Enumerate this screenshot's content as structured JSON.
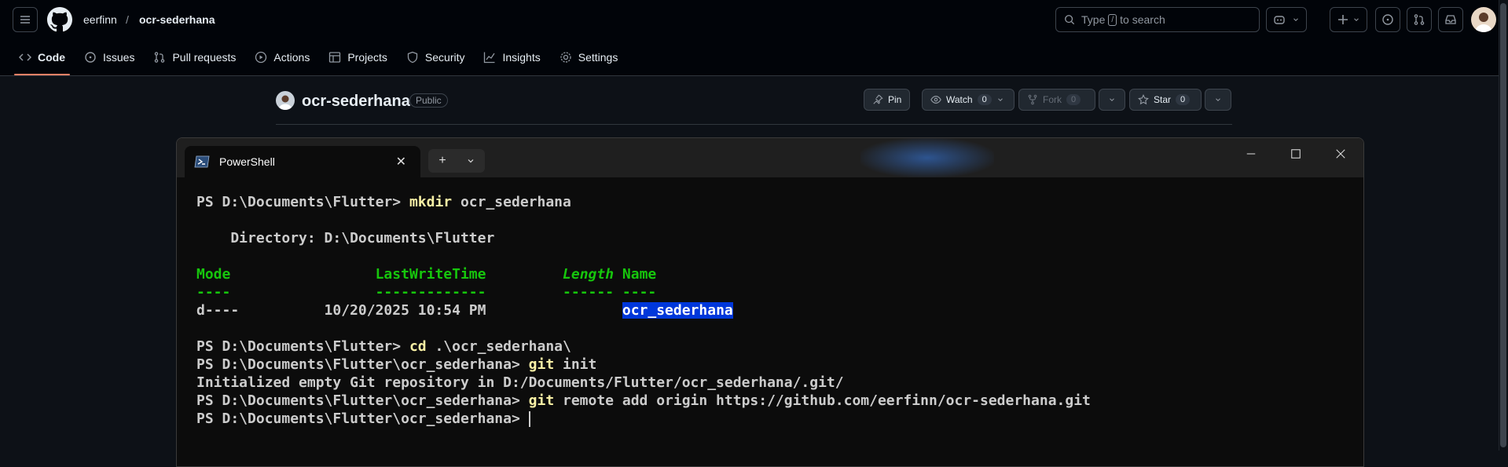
{
  "github": {
    "owner": "eerfinn",
    "separator": "/",
    "repo": "ocr-sederhana",
    "search_placeholder_prefix": "Type",
    "search_key": "/",
    "search_placeholder_suffix": "to search",
    "nav": [
      {
        "label": "Code",
        "icon": "code-icon",
        "active": true
      },
      {
        "label": "Issues",
        "icon": "issue-icon"
      },
      {
        "label": "Pull requests",
        "icon": "pull-request-icon"
      },
      {
        "label": "Actions",
        "icon": "play-icon"
      },
      {
        "label": "Projects",
        "icon": "table-icon"
      },
      {
        "label": "Security",
        "icon": "shield-icon"
      },
      {
        "label": "Insights",
        "icon": "graph-icon"
      },
      {
        "label": "Settings",
        "icon": "gear-icon"
      }
    ],
    "repo_title": "ocr-sederhana",
    "visibility": "Public",
    "pin_label": "Pin",
    "watch_label": "Watch",
    "watch_count": "0",
    "fork_label": "Fork",
    "fork_count": "0",
    "star_label": "Star",
    "star_count": "0",
    "accent": "#f78166"
  },
  "terminal": {
    "tab_title": "PowerShell",
    "lines": [
      {
        "parts": [
          {
            "t": "PS D:\\Documents\\Flutter> "
          },
          {
            "t": "mkdir",
            "c": "cmd"
          },
          {
            "t": " ocr_sederhana"
          }
        ]
      },
      {
        "parts": [
          {
            "t": ""
          }
        ]
      },
      {
        "parts": [
          {
            "t": "    Directory: D:\\Documents\\Flutter"
          }
        ]
      },
      {
        "parts": [
          {
            "t": ""
          }
        ]
      },
      {
        "parts": [
          {
            "t": "Mode",
            "c": "hdr"
          },
          {
            "t": "                 "
          },
          {
            "t": "LastWriteTime",
            "c": "hdr"
          },
          {
            "t": "         "
          },
          {
            "t": "Length",
            "c": "hdr-it"
          },
          {
            "t": " "
          },
          {
            "t": "Name",
            "c": "hdr"
          }
        ]
      },
      {
        "parts": [
          {
            "t": "----",
            "c": "hdr"
          },
          {
            "t": "                 "
          },
          {
            "t": "-------------",
            "c": "hdr"
          },
          {
            "t": "         "
          },
          {
            "t": "------",
            "c": "hdr"
          },
          {
            "t": " "
          },
          {
            "t": "----",
            "c": "hdr"
          }
        ]
      },
      {
        "parts": [
          {
            "t": "d----          10/20/2025 10:54 PM                "
          },
          {
            "t": "ocr_sederhana",
            "c": "hl"
          }
        ]
      },
      {
        "parts": [
          {
            "t": ""
          }
        ]
      },
      {
        "parts": [
          {
            "t": "PS D:\\Documents\\Flutter> "
          },
          {
            "t": "cd",
            "c": "cmd"
          },
          {
            "t": " .\\ocr_sederhana\\"
          }
        ]
      },
      {
        "parts": [
          {
            "t": "PS D:\\Documents\\Flutter\\ocr_sederhana> "
          },
          {
            "t": "git",
            "c": "cmd"
          },
          {
            "t": " init"
          }
        ]
      },
      {
        "parts": [
          {
            "t": "Initialized empty Git repository in D:/Documents/Flutter/ocr_sederhana/.git/"
          }
        ]
      },
      {
        "parts": [
          {
            "t": "PS D:\\Documents\\Flutter\\ocr_sederhana> "
          },
          {
            "t": "git",
            "c": "cmd"
          },
          {
            "t": " remote add origin https://github.com/eerfinn/ocr-sederhana.git"
          }
        ]
      },
      {
        "parts": [
          {
            "t": "PS D:\\Documents\\Flutter\\ocr_sederhana> "
          },
          {
            "t": "",
            "c": "cursor"
          }
        ]
      }
    ]
  }
}
